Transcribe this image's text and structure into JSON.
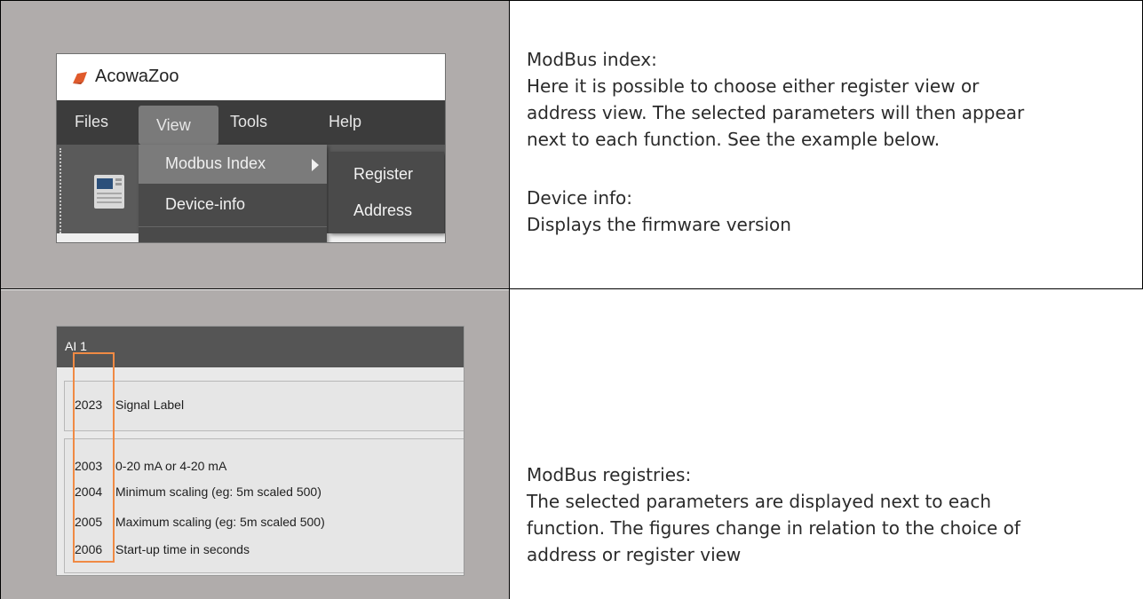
{
  "colors": {
    "cell_gray": "#b0acab",
    "menubar": "#3c3c3c",
    "dropdown": "#4a4a4a",
    "highlight": "#f08a44",
    "logo": "#e05a2b"
  },
  "row1": {
    "screenshot": {
      "app_title": "AcowaZoo",
      "app_icon": "acowazoo-logo-icon",
      "menu": [
        "Files",
        "View",
        "Tools",
        "Help"
      ],
      "dropdown": [
        "Modbus Index",
        "Device-info"
      ],
      "submenu": [
        "Register",
        "Address"
      ]
    },
    "sections": [
      {
        "heading": "ModBus index:",
        "lines": [
          "Here it is possible to choose either register view or",
          "address view. The selected parameters will then appear",
          "next to each function. See the example below."
        ]
      },
      {
        "heading": "Device info:",
        "lines": [
          "Displays the firmware version"
        ]
      }
    ]
  },
  "row2": {
    "screenshot": {
      "header": "AI 1",
      "groups": [
        [
          {
            "number": "2023",
            "label": "Signal Label"
          }
        ],
        [
          {
            "number": "2003",
            "label": "0-20 mA or 4-20 mA"
          },
          {
            "number": "2004",
            "label": "Minimum scaling (eg: 5m scaled 500)"
          },
          {
            "number": "2005",
            "label": "Maximum scaling (eg: 5m scaled 500)"
          },
          {
            "number": "2006",
            "label": "Start-up time in seconds"
          }
        ]
      ]
    },
    "section": {
      "heading": "ModBus registries:",
      "lines": [
        "The selected parameters are displayed next to each",
        "function. The figures change in relation to the choice of",
        "address or register view"
      ]
    }
  }
}
